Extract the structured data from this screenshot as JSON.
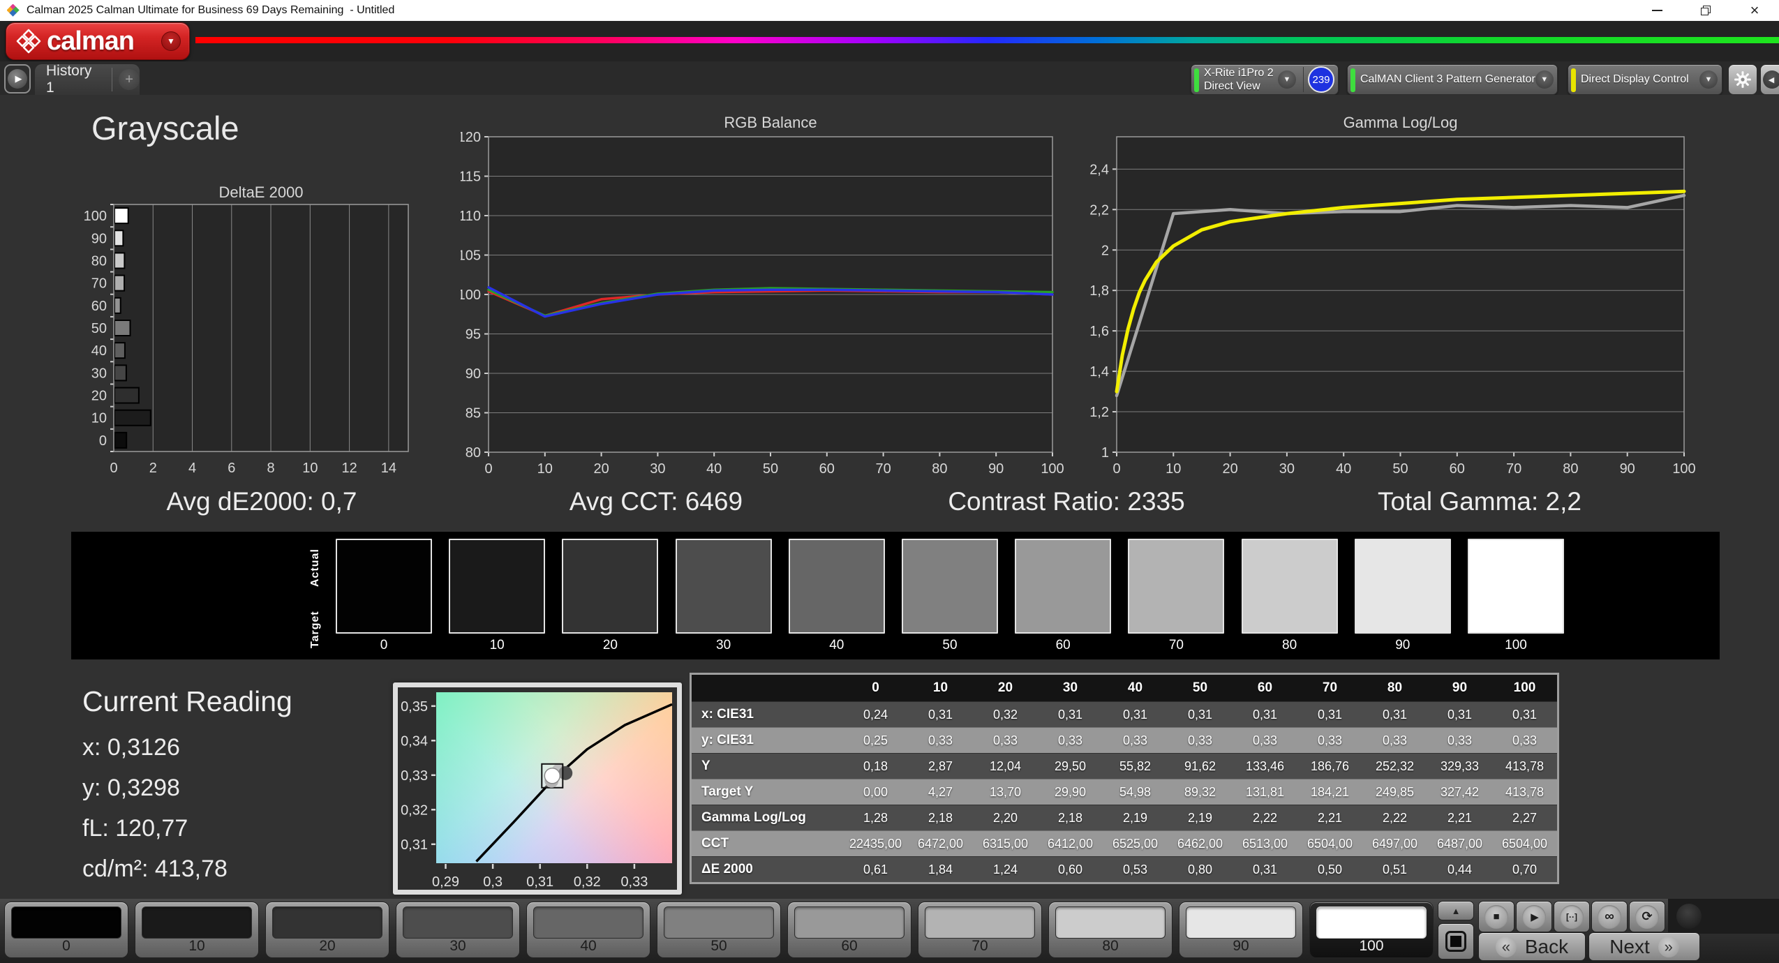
{
  "window": {
    "title": "Calman 2025 Calman Ultimate for Business 69 Days Remaining  - Untitled"
  },
  "header": {
    "logo_text": "calman"
  },
  "tabs": {
    "history_tab": "History 1"
  },
  "devices": {
    "meter_line1": "X-Rite i1Pro 2",
    "meter_line2": "Direct View",
    "meter_badge": "239",
    "pattern_generator": "CalMAN Client 3 Pattern Generator",
    "display_control": "Direct Display Control"
  },
  "page_title": "Grayscale",
  "stats": {
    "avg_de2000": "Avg dE2000: 0,7",
    "avg_cct": "Avg CCT: 6469",
    "contrast_ratio": "Contrast Ratio: 2335",
    "total_gamma": "Total Gamma: 2,2"
  },
  "icons": {
    "play": "▶",
    "add": "+",
    "caret": "▼",
    "collapse": "◀",
    "close": "×",
    "stop": "■",
    "pattern_window": "[··]",
    "loop": "∞",
    "refresh": "⟳",
    "up": "▲",
    "back_chevron": "«",
    "next_chevron": "»"
  },
  "chart_data": [
    {
      "id": "deltae",
      "type": "bar",
      "orientation": "horizontal",
      "title": "DeltaE 2000",
      "categories": [
        "100",
        "90",
        "80",
        "70",
        "60",
        "50",
        "40",
        "30",
        "20",
        "10",
        "0"
      ],
      "values": [
        0.7,
        0.44,
        0.51,
        0.5,
        0.31,
        0.8,
        0.53,
        0.6,
        1.24,
        1.84,
        0.61
      ],
      "bar_colors": [
        "#ffffff",
        "#e3e3e3",
        "#c9c9c9",
        "#aeaeae",
        "#949494",
        "#7a7a7a",
        "#5f5f5f",
        "#454545",
        "#2e2e2e",
        "#1c1c1c",
        "#0c0c0c"
      ],
      "xlim": [
        0,
        15
      ],
      "xticks": [
        0,
        2,
        4,
        6,
        8,
        10,
        12,
        14
      ],
      "grid": true
    },
    {
      "id": "rgb_balance",
      "type": "line",
      "title": "RGB Balance",
      "x": [
        0,
        10,
        20,
        30,
        40,
        50,
        60,
        70,
        80,
        90,
        100
      ],
      "xticks": [
        0,
        10,
        20,
        30,
        40,
        50,
        60,
        70,
        80,
        90,
        100
      ],
      "ylim": [
        80,
        120
      ],
      "yticks": [
        80,
        85,
        90,
        95,
        100,
        105,
        110,
        115,
        120
      ],
      "series": [
        {
          "name": "Red balance",
          "color": "#de2828",
          "values": [
            100.4,
            97.3,
            99.4,
            100.0,
            100.3,
            100.4,
            100.5,
            100.4,
            100.3,
            100.3,
            100.0
          ]
        },
        {
          "name": "Green balance",
          "color": "#28a028",
          "values": [
            100.6,
            97.3,
            98.9,
            100.1,
            100.6,
            100.8,
            100.7,
            100.6,
            100.5,
            100.4,
            100.3
          ]
        },
        {
          "name": "Blue balance",
          "color": "#2832e6",
          "values": [
            100.9,
            97.2,
            98.8,
            100.0,
            100.5,
            100.6,
            100.6,
            100.5,
            100.4,
            100.3,
            100.0
          ]
        }
      ],
      "grid": true,
      "legend": "none"
    },
    {
      "id": "gamma",
      "type": "line",
      "title": "Gamma Log/Log",
      "xticks": [
        0,
        10,
        20,
        30,
        40,
        50,
        60,
        70,
        80,
        90,
        100
      ],
      "ylim": [
        1,
        2.56
      ],
      "yticks": [
        1,
        1.2,
        1.4,
        1.6,
        1.8,
        2,
        2.2,
        2.4
      ],
      "ytick_labels": [
        "1",
        "1,2",
        "1,4",
        "1,6",
        "1,8",
        "2",
        "2,2",
        "2,4"
      ],
      "series": [
        {
          "name": "Measured gamma",
          "color": "#a6a6a6",
          "x": [
            0,
            10,
            20,
            30,
            40,
            50,
            60,
            70,
            80,
            90,
            100
          ],
          "values": [
            1.28,
            2.18,
            2.2,
            2.18,
            2.19,
            2.19,
            2.22,
            2.21,
            2.22,
            2.21,
            2.27
          ]
        },
        {
          "name": "Target gamma",
          "color": "#f2ee00",
          "x": [
            0,
            1,
            2,
            3,
            4,
            5,
            7,
            10,
            15,
            20,
            25,
            30,
            40,
            50,
            60,
            70,
            80,
            90,
            100
          ],
          "values": [
            1.3,
            1.48,
            1.61,
            1.71,
            1.79,
            1.85,
            1.94,
            2.02,
            2.1,
            2.14,
            2.16,
            2.18,
            2.21,
            2.23,
            2.25,
            2.26,
            2.27,
            2.28,
            2.29
          ]
        }
      ],
      "grid": true,
      "legend": "none"
    },
    {
      "id": "cie_zoom",
      "type": "scatter",
      "title": "",
      "xlim": [
        0.288,
        0.338
      ],
      "ylim": [
        0.3045,
        0.354
      ],
      "xticks": [
        0.29,
        0.3,
        0.31,
        0.32,
        0.33
      ],
      "xtick_labels": [
        "0,29",
        "0,3",
        "0,31",
        "0,32",
        "0,33"
      ],
      "yticks": [
        0.35,
        0.34,
        0.33,
        0.32,
        0.31
      ],
      "ytick_labels": [
        "0,35",
        "0,34",
        "0,33",
        "0,32",
        "0,31"
      ],
      "locus": [
        [
          0.2965,
          0.305
        ],
        [
          0.3045,
          0.3165
        ],
        [
          0.3126,
          0.3285
        ],
        [
          0.32,
          0.3375
        ],
        [
          0.328,
          0.3445
        ],
        [
          0.338,
          0.3505
        ]
      ],
      "points": [
        {
          "x": 0.314,
          "y": 0.3313,
          "color": "#a8a8a8",
          "role": "history"
        },
        {
          "x": 0.3154,
          "y": 0.3306,
          "color": "#4d4d4d",
          "role": "reference"
        },
        {
          "x": 0.3126,
          "y": 0.3298,
          "color": "#ffffff",
          "role": "current"
        }
      ]
    }
  ],
  "grayscale_strip": {
    "row_labels": [
      "Actual",
      "Target"
    ],
    "levels": [
      "0",
      "10",
      "20",
      "30",
      "40",
      "50",
      "60",
      "70",
      "80",
      "90",
      "100"
    ],
    "colors": [
      "#020202",
      "#1a1a1a",
      "#333333",
      "#4d4d4d",
      "#666666",
      "#808080",
      "#999999",
      "#b3b3b3",
      "#cccccc",
      "#e6e6e6",
      "#ffffff"
    ]
  },
  "current_reading": {
    "title": "Current Reading",
    "x": "x: 0,3126",
    "y": "y: 0,3298",
    "fl": "fL: 120,77",
    "cdm2": "cd/m²: 413,78"
  },
  "table": {
    "columns": [
      "0",
      "10",
      "20",
      "30",
      "40",
      "50",
      "60",
      "70",
      "80",
      "90",
      "100"
    ],
    "rows": [
      {
        "label": "x: CIE31",
        "values": [
          "0,24",
          "0,31",
          "0,32",
          "0,31",
          "0,31",
          "0,31",
          "0,31",
          "0,31",
          "0,31",
          "0,31",
          "0,31"
        ]
      },
      {
        "label": "y: CIE31",
        "values": [
          "0,25",
          "0,33",
          "0,33",
          "0,33",
          "0,33",
          "0,33",
          "0,33",
          "0,33",
          "0,33",
          "0,33",
          "0,33"
        ]
      },
      {
        "label": "Y",
        "values": [
          "0,18",
          "2,87",
          "12,04",
          "29,50",
          "55,82",
          "91,62",
          "133,46",
          "186,76",
          "252,32",
          "329,33",
          "413,78"
        ]
      },
      {
        "label": "Target Y",
        "values": [
          "0,00",
          "4,27",
          "13,70",
          "29,90",
          "54,98",
          "89,32",
          "131,81",
          "184,21",
          "249,85",
          "327,42",
          "413,78"
        ]
      },
      {
        "label": "Gamma Log/Log",
        "values": [
          "1,28",
          "2,18",
          "2,20",
          "2,18",
          "2,19",
          "2,19",
          "2,22",
          "2,21",
          "2,22",
          "2,21",
          "2,27"
        ]
      },
      {
        "label": "CCT",
        "values": [
          "22435,00",
          "6472,00",
          "6315,00",
          "6412,00",
          "6525,00",
          "6462,00",
          "6513,00",
          "6504,00",
          "6497,00",
          "6487,00",
          "6504,00"
        ]
      },
      {
        "label": "ΔE 2000",
        "values": [
          "0,61",
          "1,84",
          "1,24",
          "0,60",
          "0,53",
          "0,80",
          "0,31",
          "0,50",
          "0,51",
          "0,44",
          "0,70"
        ]
      }
    ]
  },
  "pattern_toolbar": {
    "levels": [
      "0",
      "10",
      "20",
      "30",
      "40",
      "50",
      "60",
      "70",
      "80",
      "90",
      "100"
    ],
    "colors": [
      "#020202",
      "#1a1a1a",
      "#333333",
      "#4d4d4d",
      "#666666",
      "#808080",
      "#999999",
      "#b3b3b3",
      "#cccccc",
      "#e6e6e6",
      "#ffffff"
    ],
    "selected_level": "100",
    "back_label": "Back",
    "next_label": "Next"
  }
}
